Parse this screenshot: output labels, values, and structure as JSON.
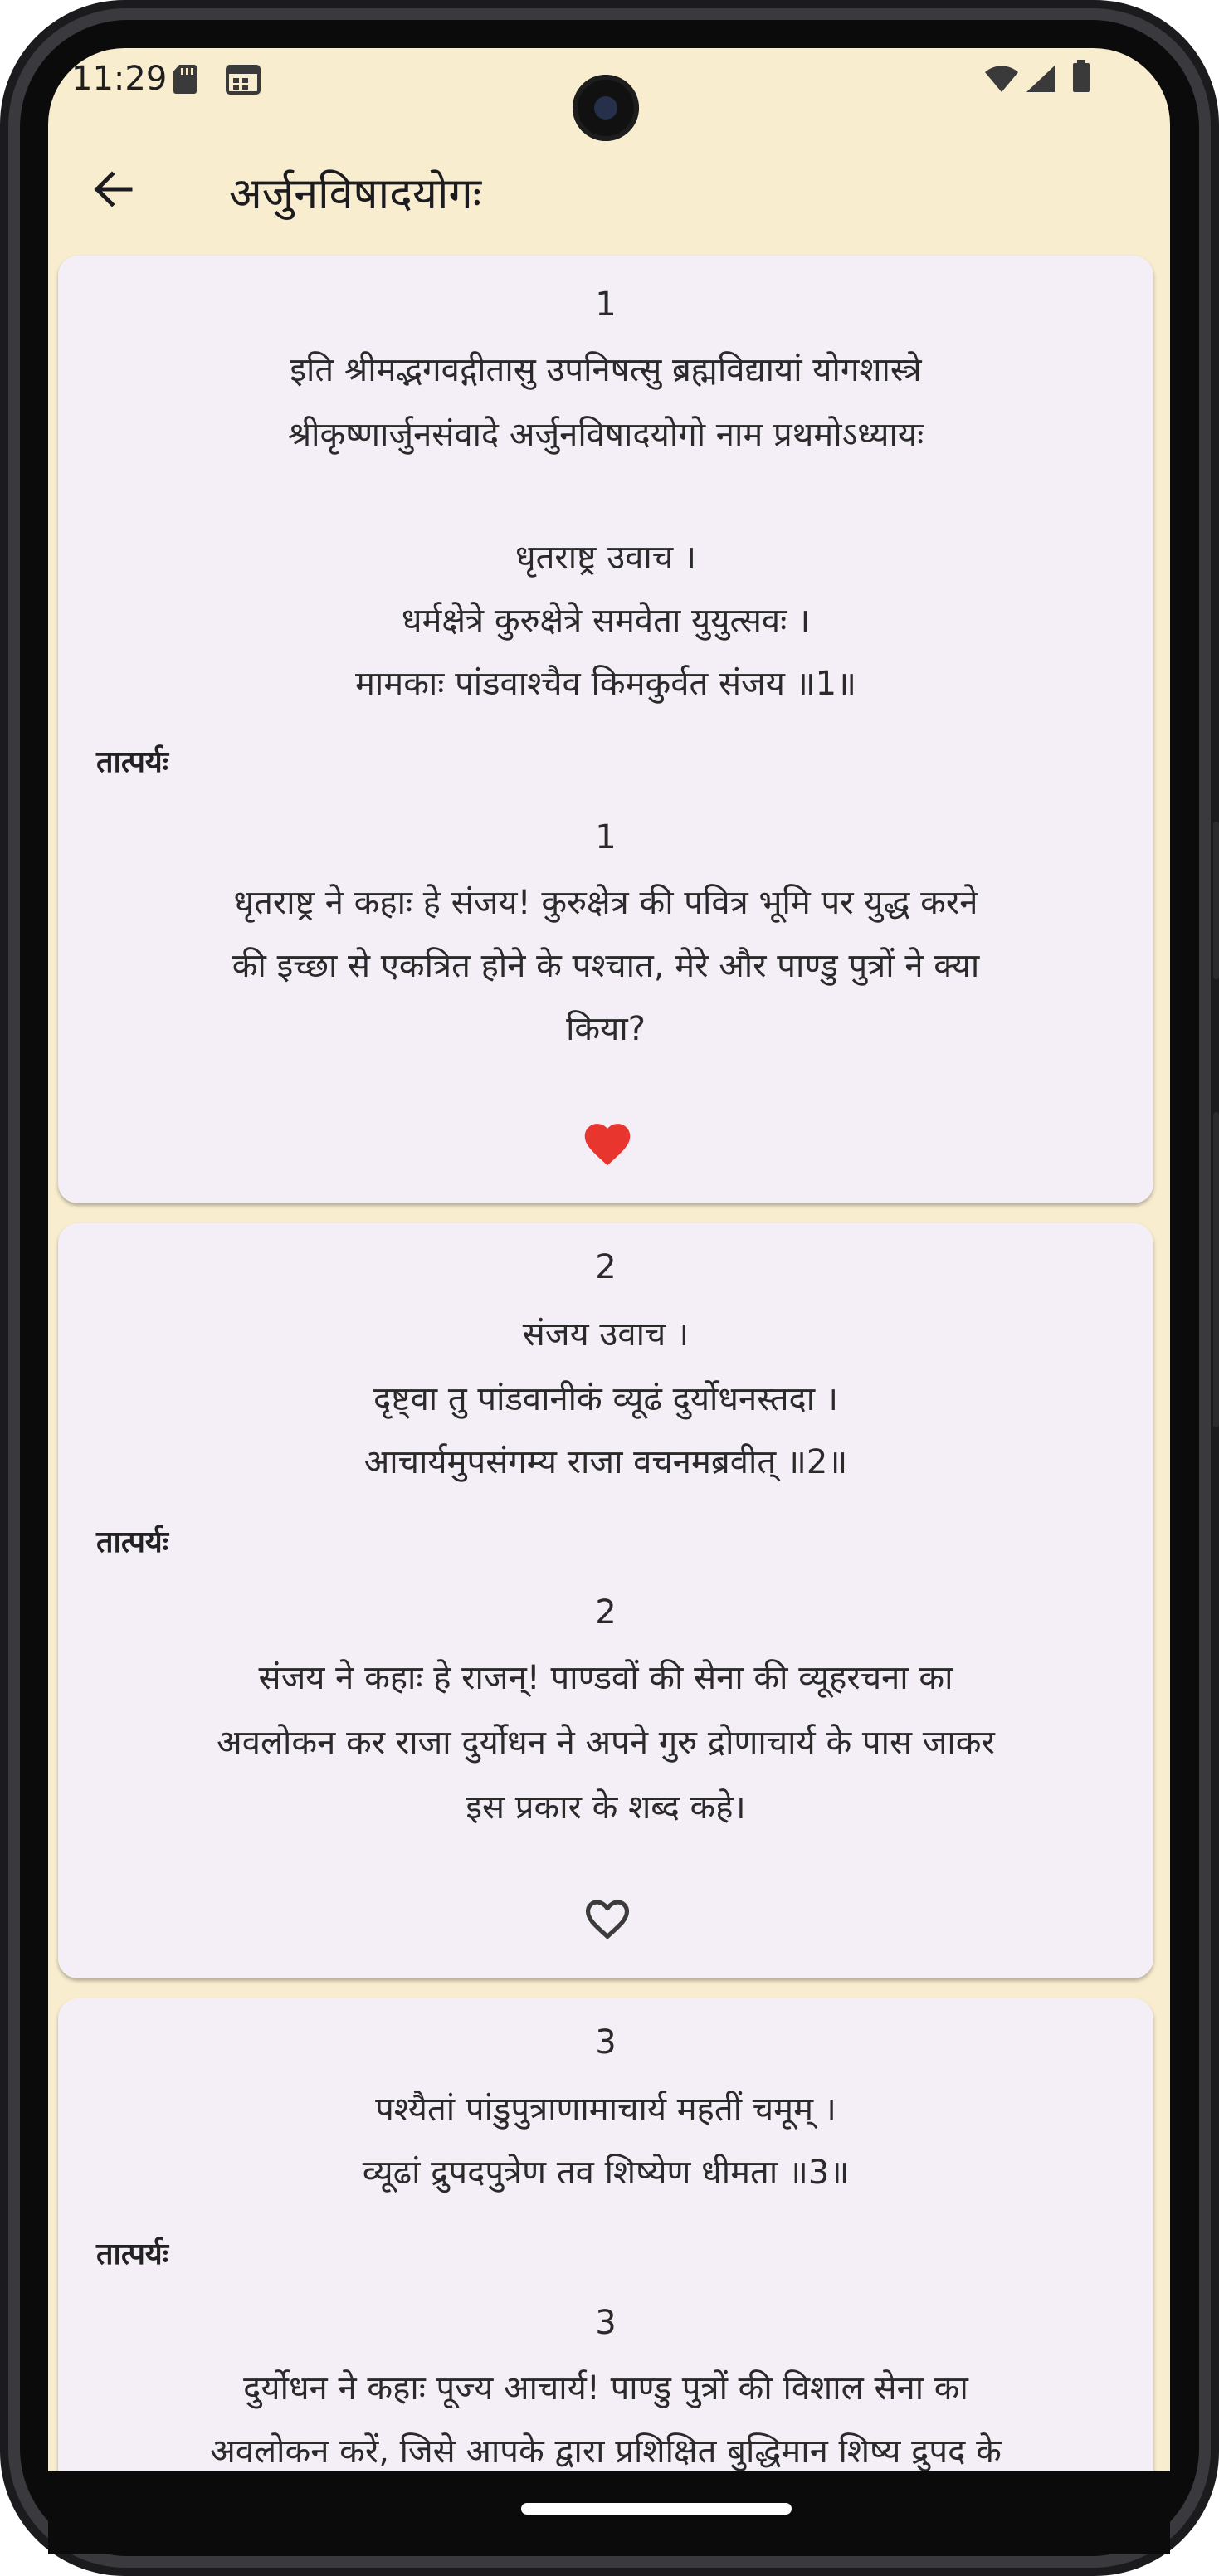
{
  "status": {
    "time": "11:29"
  },
  "appbar": {
    "title": "अर्जुनविषादयोगः"
  },
  "cards": [
    {
      "verse_number": "1",
      "sanskrit_lines": [
        "इति श्रीमद्भगवद्गीतासु उपनिषत्सु ब्रह्मविद्यायां योगशास्त्रे",
        "श्रीकृष्णार्जुनसंवादे अर्जुनविषादयोगो नाम प्रथमोऽध्यायः",
        "धृतराष्ट्र उवाच ।",
        "धर्मक्षेत्रे कुरुक्षेत्रे समवेता युयुत्सवः ।",
        "मामकाः पांडवाश्चैव किमकुर्वत संजय ॥1॥"
      ],
      "label": "तात्पर्यः",
      "meaning_number": "1",
      "meaning_lines": [
        "धृतराष्ट्र ने कहाः हे संजय! कुरुक्षेत्र की पवित्र भूमि पर युद्ध करने",
        "की इच्छा से एकत्रित होने के पश्चात, मेरे और पाण्डु पुत्रों ने क्या",
        "किया?"
      ],
      "favorite": true
    },
    {
      "verse_number": "2",
      "sanskrit_lines": [
        "संजय उवाच ।",
        "दृष्ट्वा तु पांडवानीकं व्यूढं दुर्योधनस्तदा ।",
        "आचार्यमुपसंगम्य राजा वचनमब्रवीत् ॥2॥"
      ],
      "label": "तात्पर्यः",
      "meaning_number": "2",
      "meaning_lines": [
        "संजय ने कहाः हे राजन्! पाण्डवों की सेना की व्यूहरचना का",
        "अवलोकन कर राजा दुर्योधन ने अपने गुरु द्रोणाचार्य के पास जाकर",
        "इस प्रकार के शब्द कहे।"
      ],
      "favorite": false
    },
    {
      "verse_number": "3",
      "sanskrit_lines": [
        "पश्यैतां पांडुपुत्राणामाचार्य महतीं चमूम् ।",
        "व्यूढां द्रुपदपुत्रेण तव शिष्येण धीमता ॥3॥"
      ],
      "label": "तात्पर्यः",
      "meaning_number": "3",
      "meaning_lines": [
        "दुर्योधन ने कहाः पूज्य आचार्य! पाण्डु पुत्रों की विशाल सेना का",
        "अवलोकन करें, जिसे आपके द्वारा प्रशिक्षित बुद्धिमान शिष्य द्रुपद के"
      ]
    }
  ],
  "colors": {
    "app_background": "#f9edcf",
    "card_background": "#f4eff6",
    "favorite_red": "#e8352e",
    "outline_dark": "#3b3b3b"
  }
}
